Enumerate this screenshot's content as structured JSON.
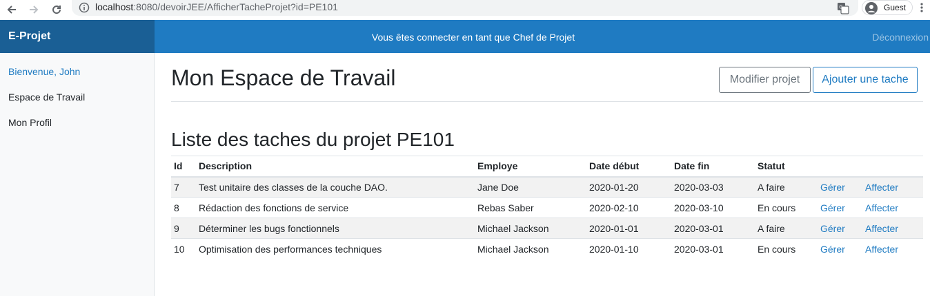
{
  "browser": {
    "url_host": "localhost",
    "url_rest": ":8080/devoirJEE/AfficherTacheProjet?id=PE101",
    "profile_label": "Guest"
  },
  "navbar": {
    "brand": "E-Projet",
    "message": "Vous êtes connecter en tant que Chef de Projet",
    "logout": "Déconnexion"
  },
  "sidebar": {
    "items": [
      {
        "label": "Bienvenue, John"
      },
      {
        "label": "Espace de Travail"
      },
      {
        "label": "Mon Profil"
      }
    ]
  },
  "main": {
    "title": "Mon Espace de Travail",
    "edit_button": "Modifier projet",
    "add_button": "Ajouter une tache",
    "list_title": "Liste des taches du projet PE101",
    "columns": [
      "Id",
      "Description",
      "Employe",
      "Date début",
      "Date fin",
      "Statut",
      "",
      ""
    ],
    "rows": [
      {
        "id": "7",
        "description": "Test unitaire des classes de la couche DAO.",
        "employe": "Jane Doe",
        "debut": "2020-01-20",
        "fin": "2020-03-03",
        "statut": "A faire",
        "gerer": "Gérer",
        "affecter": "Affecter"
      },
      {
        "id": "8",
        "description": "Rédaction des fonctions de service",
        "employe": "Rebas Saber",
        "debut": "2020-02-10",
        "fin": "2020-03-10",
        "statut": "En cours",
        "gerer": "Gérer",
        "affecter": "Affecter"
      },
      {
        "id": "9",
        "description": "Déterminer les bugs fonctionnels",
        "employe": "Michael Jackson",
        "debut": "2020-01-01",
        "fin": "2020-03-01",
        "statut": "A faire",
        "gerer": "Gérer",
        "affecter": "Affecter"
      },
      {
        "id": "10",
        "description": "Optimisation des performances techniques",
        "employe": "Michael Jackson",
        "debut": "2020-01-10",
        "fin": "2020-03-01",
        "statut": "En cours",
        "gerer": "Gérer",
        "affecter": "Affecter"
      }
    ]
  },
  "colors": {
    "navbar": "#1f7bc2",
    "brand_bg": "#1a5f95",
    "link": "#1f7bc2"
  }
}
